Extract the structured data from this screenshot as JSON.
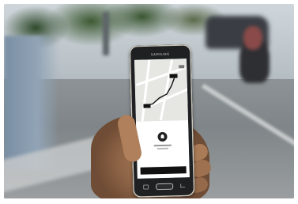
{
  "phone": {
    "brand_label": "SAMSUNG"
  },
  "app": {
    "panel_prompt": "",
    "confirm_button_label": ""
  }
}
